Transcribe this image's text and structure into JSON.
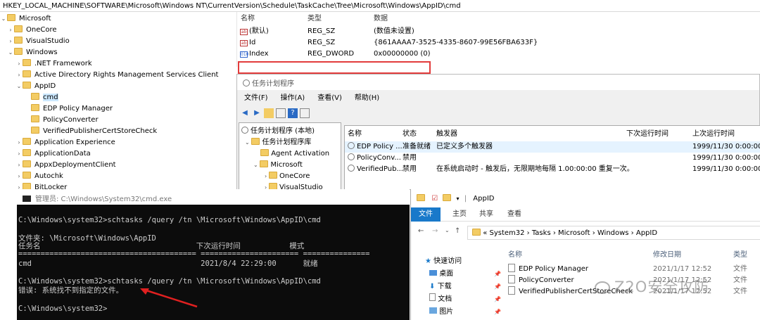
{
  "registry": {
    "path": "HKEY_LOCAL_MACHINE\\SOFTWARE\\Microsoft\\Windows NT\\CurrentVersion\\Schedule\\TaskCache\\Tree\\Microsoft\\Windows\\AppID\\cmd",
    "tree": [
      {
        "label": "Microsoft",
        "toggle": "⌄"
      },
      {
        "label": "OneCore",
        "toggle": "›"
      },
      {
        "label": "VisualStudio",
        "toggle": "›"
      },
      {
        "label": "Windows",
        "toggle": "⌄"
      },
      {
        "label": ".NET Framework",
        "toggle": "›"
      },
      {
        "label": "Active Directory Rights Management Services Client",
        "toggle": "›"
      },
      {
        "label": "AppID",
        "toggle": "⌄"
      },
      {
        "label": "cmd",
        "toggle": ""
      },
      {
        "label": "EDP Policy Manager",
        "toggle": ""
      },
      {
        "label": "PolicyConverter",
        "toggle": ""
      },
      {
        "label": "VerifiedPublisherCertStoreCheck",
        "toggle": ""
      },
      {
        "label": "Application Experience",
        "toggle": "›"
      },
      {
        "label": "ApplicationData",
        "toggle": "›"
      },
      {
        "label": "AppxDeploymentClient",
        "toggle": "›"
      },
      {
        "label": "Autochk",
        "toggle": "›"
      },
      {
        "label": "BitLocker",
        "toggle": "›"
      }
    ],
    "headers": [
      "名称",
      "类型",
      "数据"
    ],
    "values": [
      {
        "name": "(默认)",
        "type": "REG_SZ",
        "data": "(数值未设置)",
        "icon": "ab"
      },
      {
        "name": "Id",
        "type": "REG_SZ",
        "data": "{861AAAA7-3525-4335-8607-99E56FBA633F}",
        "icon": "ab"
      },
      {
        "name": "Index",
        "type": "REG_DWORD",
        "data": "0x00000000 (0)",
        "icon": "010"
      }
    ]
  },
  "task_scheduler": {
    "title": "任务计划程序",
    "menu": [
      "文件(F)",
      "操作(A)",
      "查看(V)",
      "帮助(H)"
    ],
    "tree": [
      "任务计划程序 (本地)",
      "任务计划程序库",
      "Agent Activation",
      "Microsoft",
      "OneCore",
      "VisualStudio"
    ],
    "headers": [
      "名称",
      "状态",
      "触发器",
      "下次运行时间",
      "上次运行时间"
    ],
    "rows": [
      {
        "name": "EDP Policy ...",
        "status": "准备就绪",
        "trigger": "已定义多个触发器",
        "next": "",
        "last": "1999/11/30 0:00:00"
      },
      {
        "name": "PolicyConv...",
        "status": "禁用",
        "trigger": "",
        "next": "",
        "last": "1999/11/30 0:00:00"
      },
      {
        "name": "VerifiedPub...",
        "status": "禁用",
        "trigger": "在系统启动时 - 触发后，无限期地每隔 1.00:00:00 重复一次。",
        "next": "",
        "last": "1999/11/30 0:00:00"
      }
    ]
  },
  "cmd": {
    "title": "管理员: C:\\Windows\\System32\\cmd.exe",
    "lines": [
      "C:\\Windows\\system32>schtasks /query /tn \\Microsoft\\Windows\\AppID\\cmd",
      "",
      "文件夹: \\Microsoft\\Windows\\AppID",
      "任务名                                   下次运行时间           模式",
      "======================================== ====================== ===============",
      "cmd                                      2021/8/4 22:29:00      就绪",
      "",
      "C:\\Windows\\system32>schtasks /query /tn \\Microsoft\\Windows\\AppID\\cmd",
      "错误: 系统找不到指定的文件。",
      "",
      "C:\\Windows\\system32>"
    ]
  },
  "explorer": {
    "title": "AppID",
    "ribbon": [
      "文件",
      "主页",
      "共享",
      "查看"
    ],
    "breadcrumb": "« System32 › Tasks › Microsoft › Windows › AppID",
    "nav": [
      "快速访问",
      "桌面",
      "下载",
      "文档",
      "图片"
    ],
    "headers": [
      "名称",
      "修改日期",
      "类型"
    ],
    "files": [
      {
        "name": "EDP Policy Manager",
        "date": "2021/1/17 12:52",
        "type": "文件"
      },
      {
        "name": "PolicyConverter",
        "date": "2021/1/17 12:52",
        "type": "文件"
      },
      {
        "name": "VerifiedPublisherCertStoreCheck",
        "date": "2021/1/17 12:52",
        "type": "文件"
      }
    ]
  },
  "watermark": "Z2O安全攻防"
}
